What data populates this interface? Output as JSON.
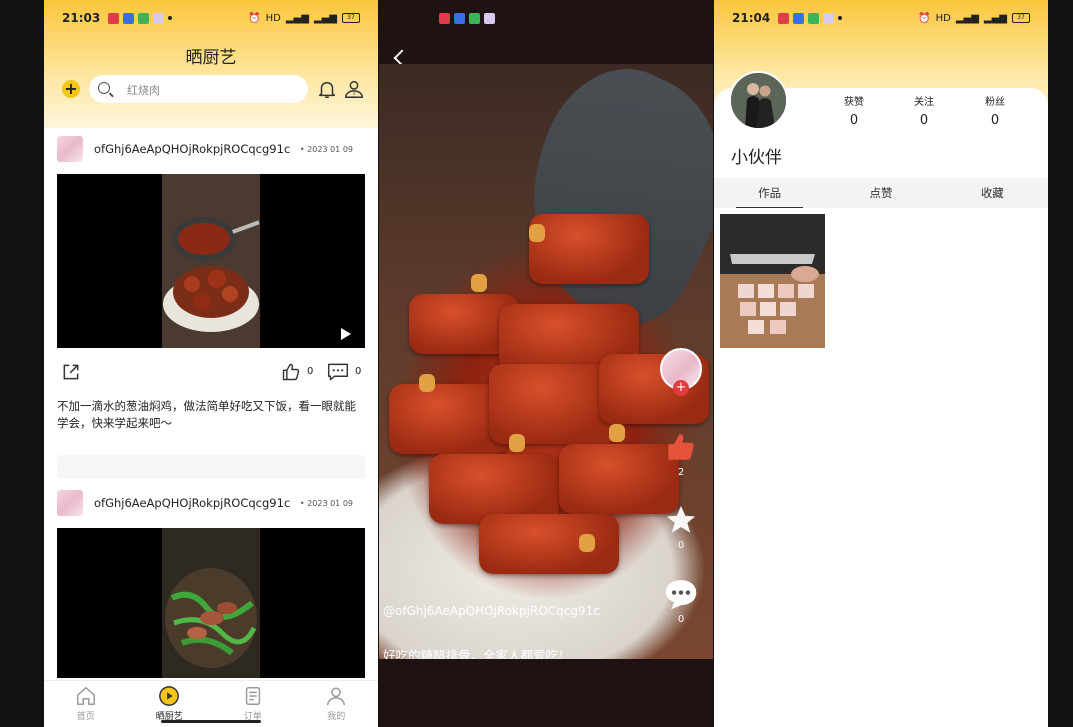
{
  "screen1": {
    "status": {
      "time": "21:03",
      "signal": "HD",
      "battery": "37"
    },
    "title": "晒厨艺",
    "search": {
      "placeholder": "红烧肉"
    },
    "posts": [
      {
        "user": "ofGhj6AeApQHOjRokpjROCqcg91c",
        "date": "2023 01 09",
        "likes": "0",
        "comments": "0",
        "caption": "不加一滴水的葱油焖鸡，做法简单好吃又下饭，看一眼就能学会，快来学起来吧～"
      },
      {
        "user": "ofGhj6AeApQHOjRokpjROCqcg91c",
        "date": "2023 01 09"
      }
    ],
    "tabs": [
      {
        "label": "首页",
        "icon": "home-icon"
      },
      {
        "label": "晒厨艺",
        "icon": "play-icon"
      },
      {
        "label": "订单",
        "icon": "order-icon"
      },
      {
        "label": "我的",
        "icon": "profile-icon"
      }
    ]
  },
  "screen2": {
    "likes": "2",
    "favorites": "0",
    "comments": "0",
    "user": "@ofGhj6AeApQHOjRokpjROCqcg91c",
    "caption": "好吃的糖醋排骨，全家人都爱吃！"
  },
  "screen3": {
    "status": {
      "time": "21:04",
      "signal": "HD",
      "battery": "37"
    },
    "stats": [
      {
        "label": "获赞",
        "value": "0"
      },
      {
        "label": "关注",
        "value": "0"
      },
      {
        "label": "粉丝",
        "value": "0"
      }
    ],
    "nickname": "小伙伴",
    "tabs": [
      "作品",
      "点赞",
      "收藏"
    ]
  },
  "colors": {
    "accent": "#fbc63b",
    "like_red": "#e5533a"
  }
}
